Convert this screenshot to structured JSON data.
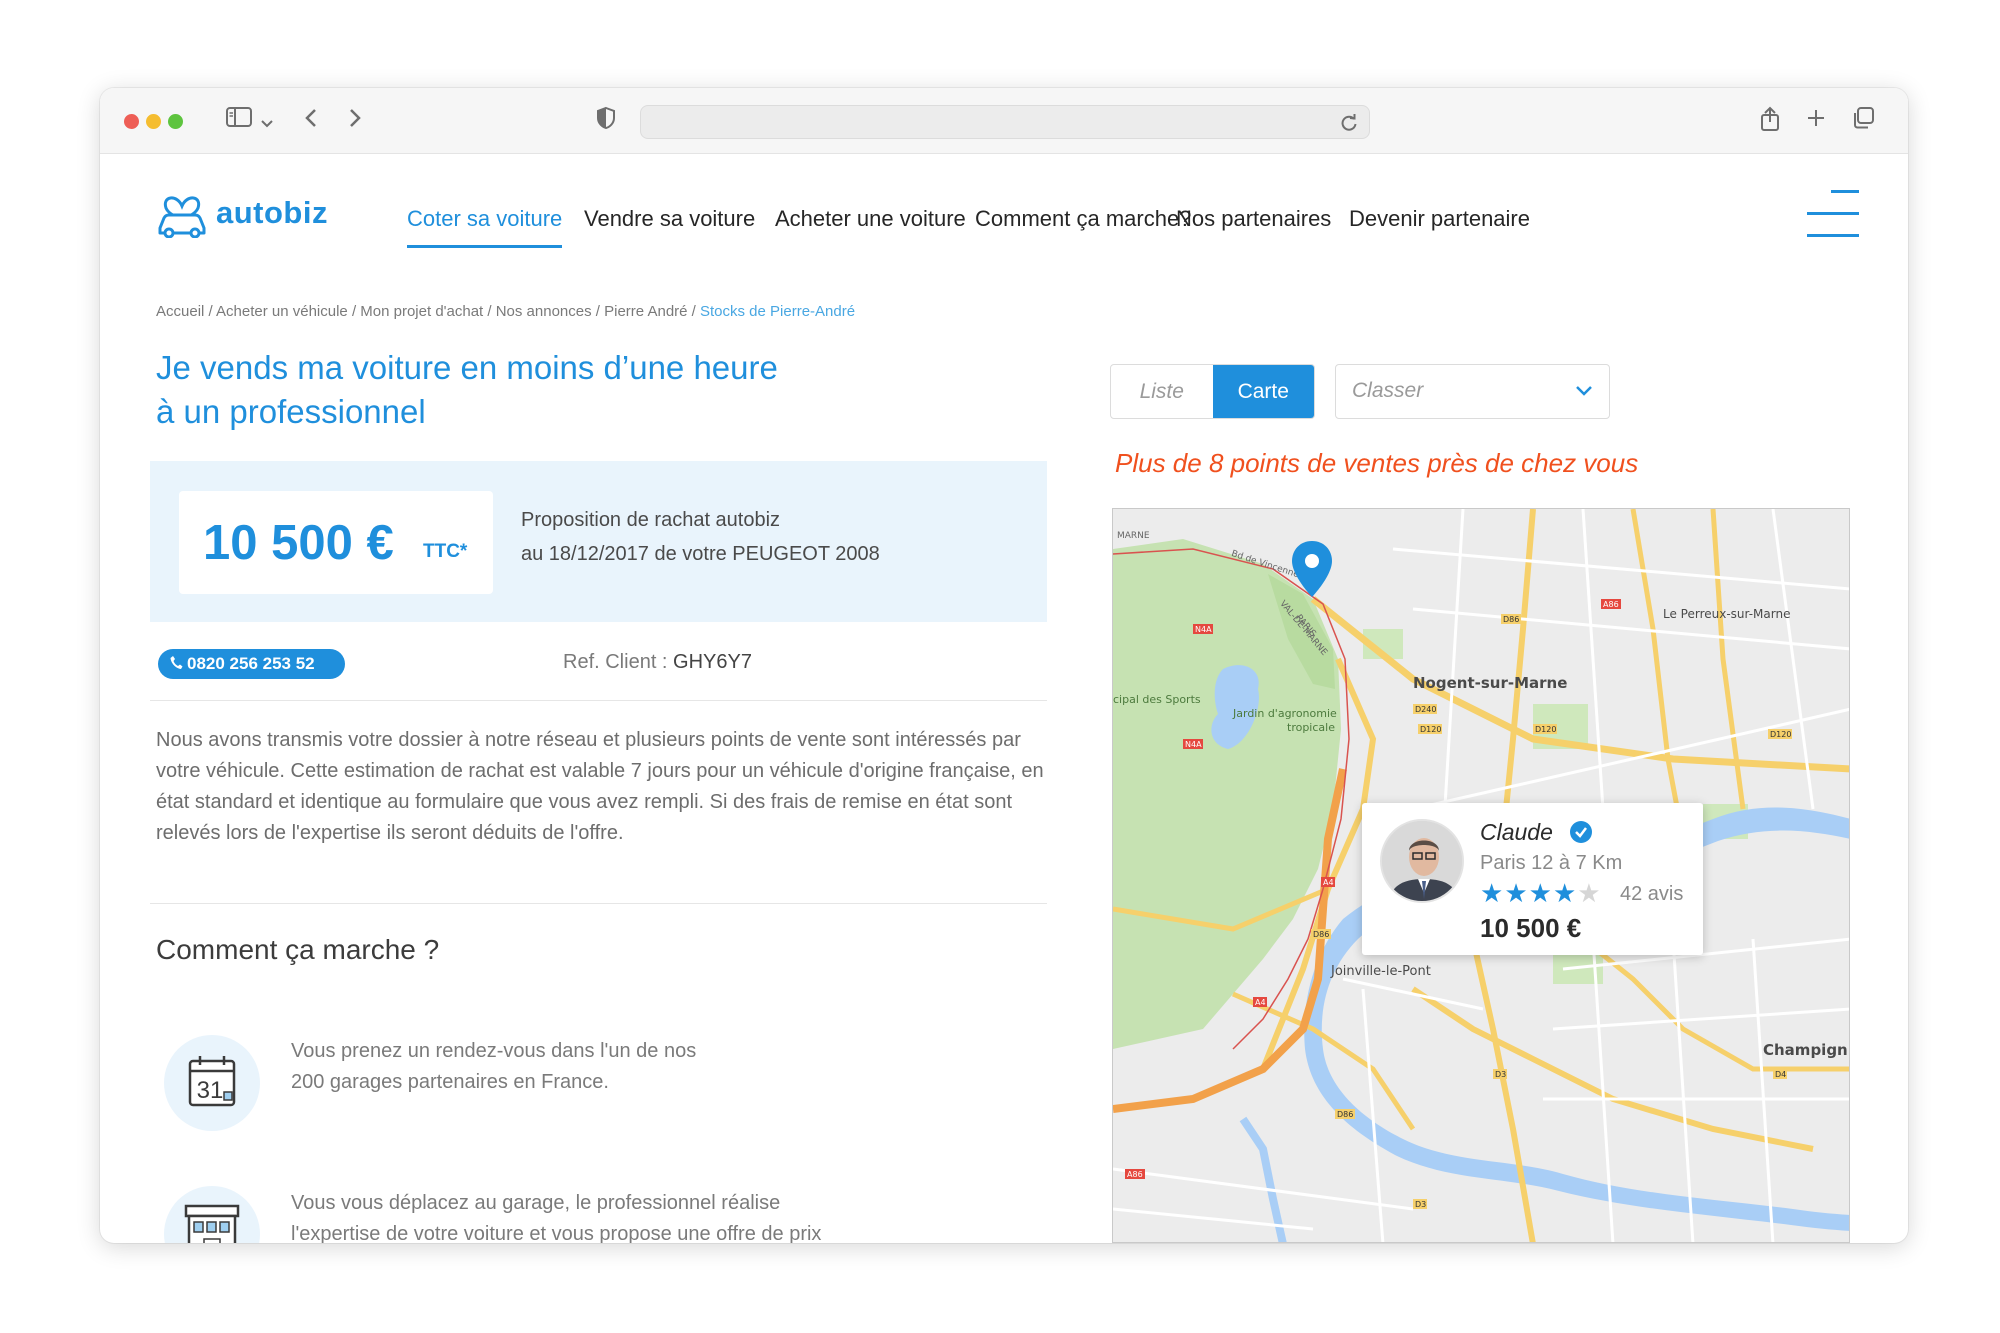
{
  "browser": {
    "url": "",
    "icons": [
      "sidebar-icon",
      "chevron-down-icon",
      "back-icon",
      "forward-icon",
      "shield-icon",
      "reload-icon",
      "share-icon",
      "new-tab-icon",
      "tabs-icon"
    ]
  },
  "site": {
    "logo_text": "autobiz",
    "nav": [
      {
        "label": "Coter sa voiture",
        "active": true
      },
      {
        "label": "Vendre sa voiture",
        "active": false
      },
      {
        "label": "Acheter une voiture",
        "active": false
      },
      {
        "label": "Comment ça marche?",
        "active": false
      },
      {
        "label": "Nos partenaires",
        "active": false
      },
      {
        "label": "Devenir partenaire",
        "active": false
      }
    ]
  },
  "breadcrumb": {
    "path": "Accueil / Acheter un véhicule / Mon projet d'achat / Nos annonces / Pierre André / ",
    "current": "Stocks de Pierre-André"
  },
  "headline": {
    "line1": "Je vends ma voiture en moins d’une heure",
    "line2": "à un professionnel"
  },
  "offer": {
    "price": "10 500 €",
    "price_suffix": "TTC*",
    "line1": "Proposition de rachat autobiz",
    "line2": "au 18/12/2017 de votre PEUGEOT 2008"
  },
  "contact": {
    "phone": "0820 256 253 52",
    "ref_label": "Ref. Client : ",
    "ref_code": "GHY6Y7"
  },
  "description": "Nous avons transmis votre dossier à notre réseau et plusieurs points de vente sont intéressés par votre véhicule. Cette estimation de rachat est valable 7 jours pour un véhicule d'origine française, en état standard et identique au formulaire que vous avez rempli. Si des frais de remise en état sont relevés lors de l'expertise ils seront déduits de l'offre.",
  "how_it_works": {
    "title": "Comment ça marche ?",
    "steps": [
      {
        "icon": "calendar-icon",
        "icon_text": "31",
        "line1": "Vous prenez un rendez-vous dans l'un de nos",
        "line2": "200 garages partenaires en France."
      },
      {
        "icon": "garage-icon",
        "line1": "Vous vous déplacez au garage, le professionnel réalise",
        "line2": "l'expertise de votre voiture et vous propose une offre de prix"
      }
    ]
  },
  "view_toggle": {
    "list_label": "Liste",
    "map_label": "Carte",
    "selected": "Carte"
  },
  "sort": {
    "placeholder": "Classer"
  },
  "points_title": "Plus de 8 points de ventes près de chez vous",
  "map": {
    "labels": {
      "nogent": "Nogent-sur-Marne",
      "perreux": "Le Perreux-sur-Marne",
      "joinville": "Joinville-le-Pont",
      "champigny": "Champign",
      "jardin": "Jardin d'agronomie",
      "tropicale": "tropicale",
      "sports": "cipal des Sports",
      "val_de_marne": "VAL-DE-MARNE",
      "paris": "PARIS",
      "marne": "MARNE",
      "vincennes": "Bd de Vincennes",
      "a4": "A4",
      "a86": "A86",
      "d120": "D120",
      "d86": "D86",
      "d240": "D240",
      "n4a": "N4A",
      "d4": "D4",
      "d3": "D3"
    }
  },
  "seller": {
    "name": "Claude",
    "location": "Paris 12 à 7 Km",
    "rating": 4,
    "max_rating": 5,
    "reviews": "42 avis",
    "price": "10 500 €",
    "star_color": "#1f8fdc",
    "star_empty_color": "#d6d6d6"
  },
  "colors": {
    "brand": "#1f8fdc",
    "accent": "#f0501e",
    "panel": "#e9f4fc"
  }
}
